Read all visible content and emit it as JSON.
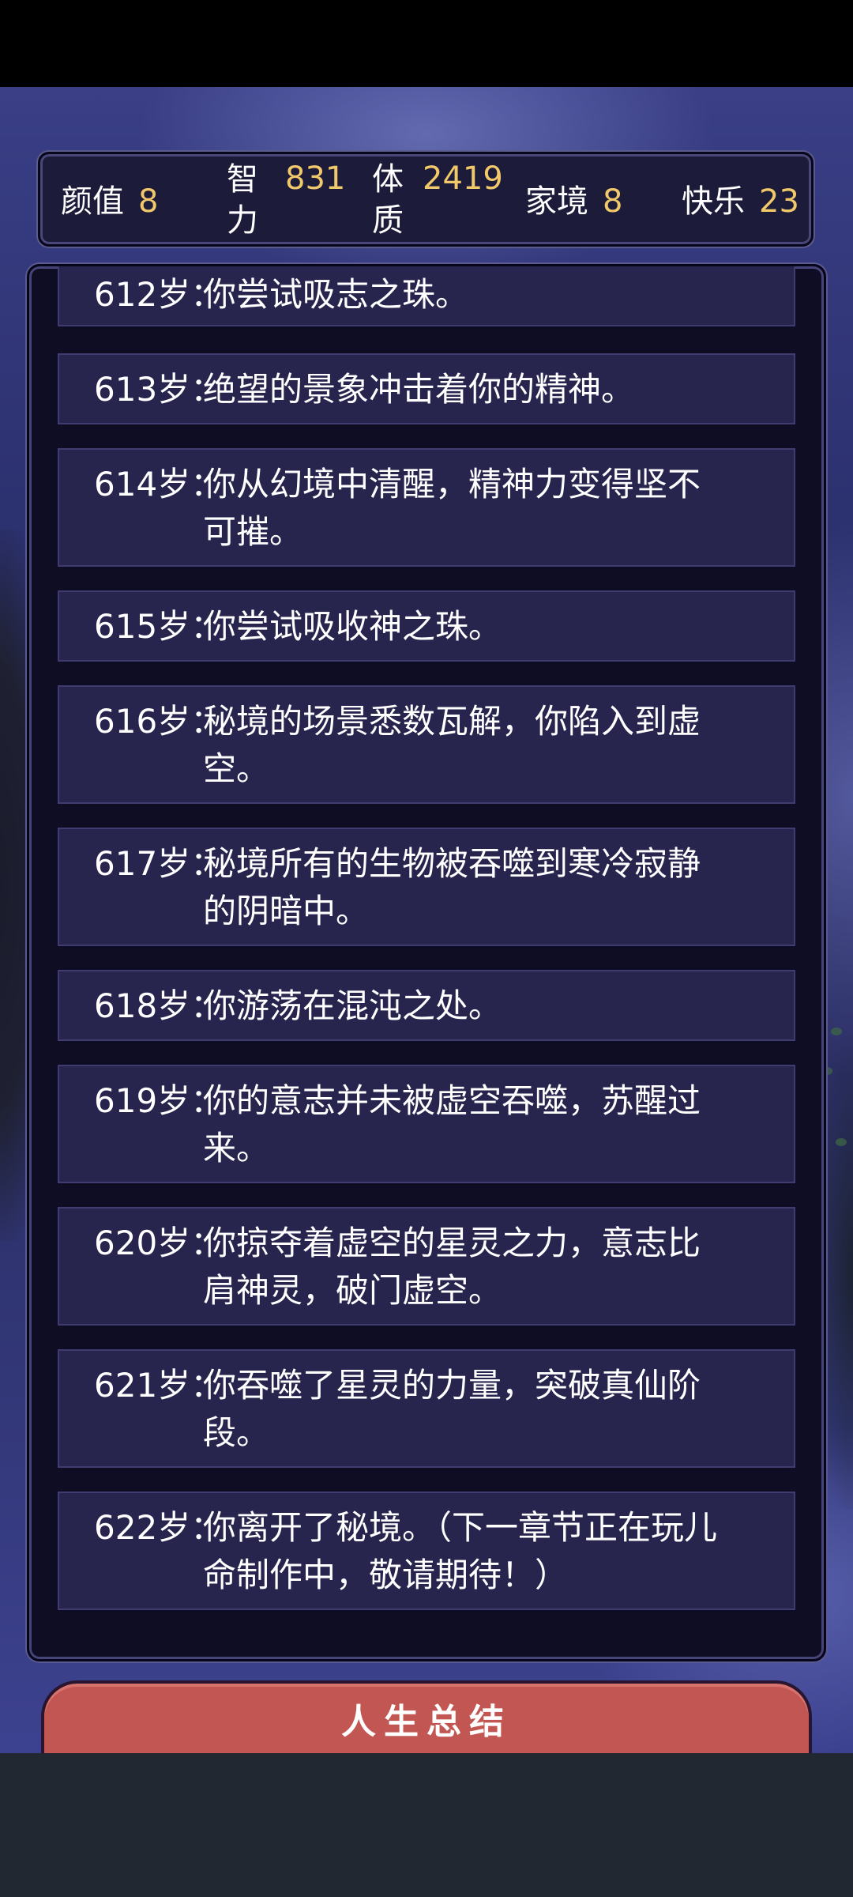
{
  "stats": {
    "appearance": {
      "label": "颜值",
      "value": "8"
    },
    "intelligence": {
      "label": "智力",
      "value": "831"
    },
    "physique": {
      "label": "体质",
      "value": "2419"
    },
    "family": {
      "label": "家境",
      "value": "8"
    },
    "happiness": {
      "label": "快乐",
      "value": "23"
    }
  },
  "log": [
    {
      "age": "612岁：",
      "text": "你尝试吸志之珠。"
    },
    {
      "age": "613岁：",
      "text": "绝望的景象冲击着你的精神。"
    },
    {
      "age": "614岁：",
      "text": "你从幻境中清醒，精神力变得坚不可摧。"
    },
    {
      "age": "615岁：",
      "text": "你尝试吸收神之珠。"
    },
    {
      "age": "616岁：",
      "text": "秘境的场景悉数瓦解，你陷入到虚空。"
    },
    {
      "age": "617岁：",
      "text": "秘境所有的生物被吞噬到寒冷寂静的阴暗中。"
    },
    {
      "age": "618岁：",
      "text": "你游荡在混沌之处。"
    },
    {
      "age": "619岁：",
      "text": "你的意志并未被虚空吞噬，苏醒过来。"
    },
    {
      "age": "620岁：",
      "text": "你掠夺着虚空的星灵之力，意志比肩神灵，破门虚空。"
    },
    {
      "age": "621岁：",
      "text": "你吞噬了星灵的力量，突破真仙阶段。"
    },
    {
      "age": "622岁：",
      "text": "你离开了秘境。（下一章节正在玩儿命制作中，敬请期待！）"
    }
  ],
  "summary_button": {
    "label": "人生总结"
  },
  "colors": {
    "stat_value": "#f1c86a",
    "button": "#c25652",
    "entry_bg": "#27244e"
  }
}
